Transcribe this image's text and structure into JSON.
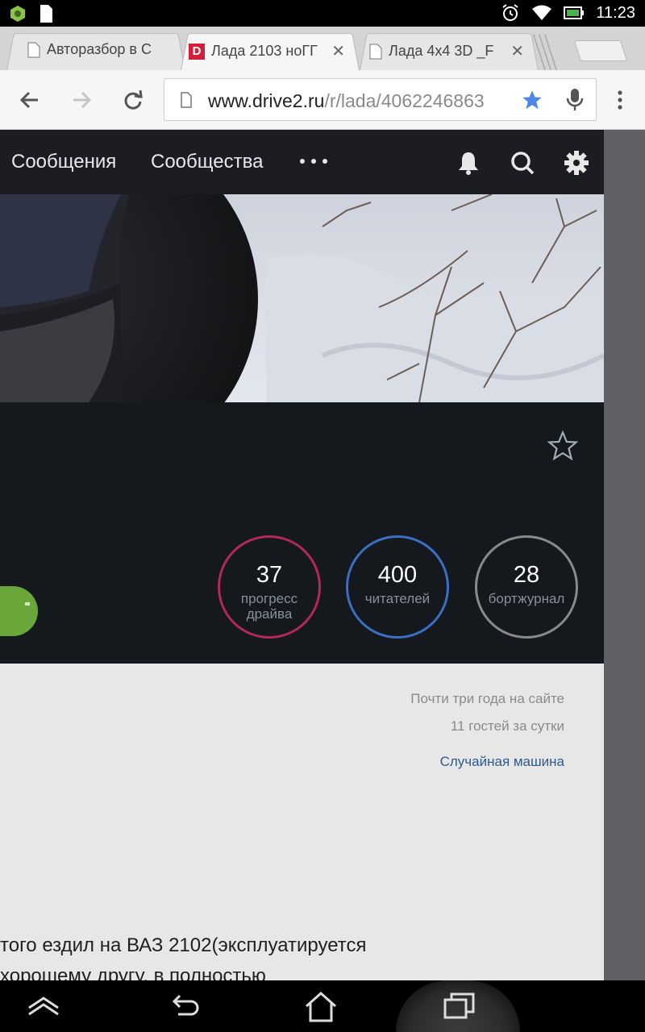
{
  "status_bar": {
    "time": "11:23"
  },
  "tabs": [
    {
      "title": "Авторазбор в С",
      "favicon": "page-icon",
      "active": false
    },
    {
      "title": "Лада 2103 ноГГ",
      "favicon": "drive2-icon",
      "favicon_letter": "D",
      "active": true,
      "close": "✕"
    },
    {
      "title": "Лада 4х4 3D _F",
      "favicon": "page-icon",
      "active": false,
      "close": "✕"
    }
  ],
  "omnibox": {
    "domain": "www.drive2.ru",
    "path": "/r/lada/4062246863"
  },
  "site_nav": {
    "links": [
      "Сообщения",
      "Сообщества"
    ],
    "more": "more-dots-icon"
  },
  "stats": [
    {
      "value": "37",
      "label_line1": "прогресс",
      "label_line2": "драйва",
      "color": "#b3285a"
    },
    {
      "value": "400",
      "label_line1": "читателей",
      "label_line2": "",
      "color": "#3a6fc4"
    },
    {
      "value": "28",
      "label_line1": "бортжурнал",
      "label_line2": "",
      "color": "#8a8a8a"
    }
  ],
  "info": {
    "member_since": "Почти три года на сайте",
    "guests": "11 гостей за сутки",
    "random_car": "Случайная машина"
  },
  "body": {
    "line1": "того ездил на ВАЗ 2102(эксплуатируется",
    "line2": "хорошему другу, в полностью"
  },
  "colors": {
    "accent_green": "#69a73b",
    "link_blue": "#2d5a8e",
    "dark_header": "#15181c"
  }
}
